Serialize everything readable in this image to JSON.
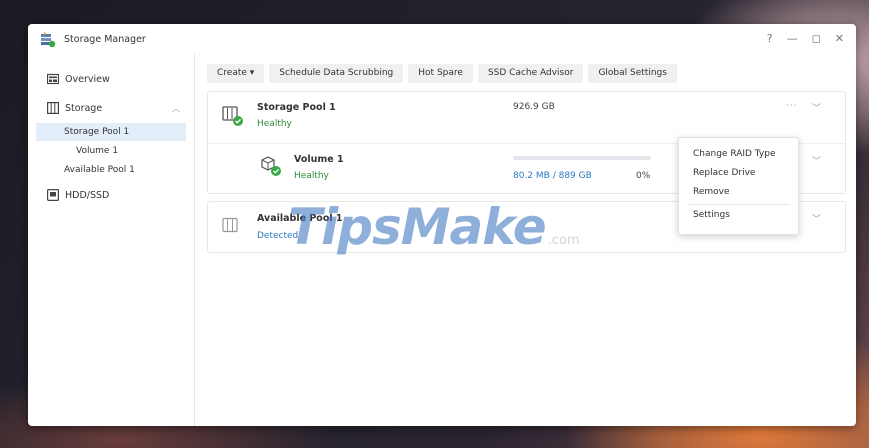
{
  "window": {
    "title": "Storage Manager",
    "controls": {
      "help": "?",
      "minimize": "—",
      "maximize": "◻",
      "close": "✕"
    }
  },
  "sidebar": {
    "items": [
      {
        "label": "Overview",
        "icon": "overview-icon"
      },
      {
        "label": "Storage",
        "icon": "storage-icon",
        "expanded": true,
        "children": [
          {
            "label": "Storage Pool 1",
            "active": true
          },
          {
            "label": "Volume 1"
          },
          {
            "label": "Available Pool 1"
          }
        ]
      },
      {
        "label": "HDD/SSD",
        "icon": "hdd-icon"
      }
    ]
  },
  "toolbar": {
    "buttons": [
      {
        "label": "Create ▾"
      },
      {
        "label": "Schedule Data Scrubbing"
      },
      {
        "label": "Hot Spare"
      },
      {
        "label": "SSD Cache Advisor"
      },
      {
        "label": "Global Settings"
      }
    ]
  },
  "storage_pool": {
    "name": "Storage Pool 1",
    "status": "Healthy",
    "capacity": "926.9 GB",
    "more": "···"
  },
  "volume": {
    "name": "Volume 1",
    "status": "Healthy",
    "usage": "80.2 MB / 889 GB",
    "percent": "0%",
    "fill_fraction": 0.0
  },
  "available_pool": {
    "name": "Available Pool 1",
    "status": "Detected",
    "more": "···"
  },
  "context_menu": {
    "items": [
      "Change RAID Type",
      "Replace Drive",
      "Remove",
      "Settings"
    ]
  },
  "watermark": {
    "main": "TipsMake",
    "sub": ".com"
  },
  "colors": {
    "accent": "#2b79c2",
    "healthy": "#2e8b3e",
    "selected_bg": "#e3eefb"
  }
}
